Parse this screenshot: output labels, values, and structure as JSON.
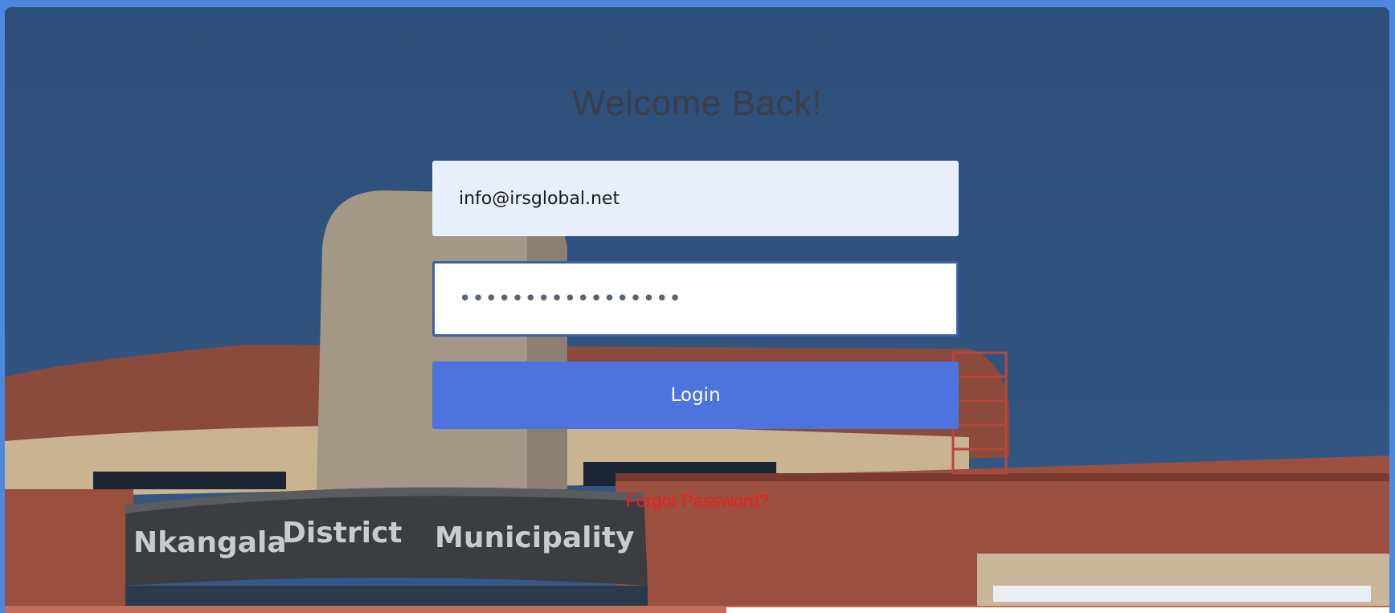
{
  "heading": "Welcome Back!",
  "email": {
    "value": "info@irsglobal.net"
  },
  "password": {
    "masked_value": "•••••••••••••••••"
  },
  "login_button": {
    "label": "Login"
  },
  "forgot_link": {
    "label": "Forgot Password?"
  },
  "background": {
    "sign_words": [
      "Nkangala",
      "District",
      "Municipality"
    ]
  },
  "colors": {
    "page_border": "#4e88dc",
    "sky": "#2f5079",
    "button": "#4d73de",
    "forgot_link": "#f01c1c",
    "email_field": "#e8eefc"
  }
}
